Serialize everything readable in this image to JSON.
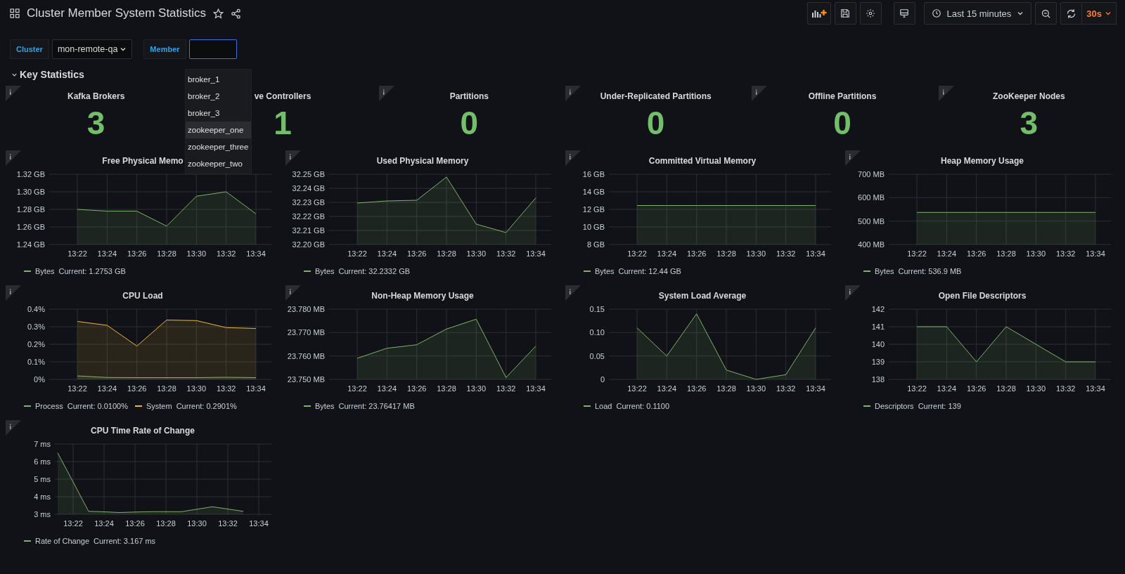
{
  "dashboard": {
    "title": "Cluster Member System Statistics"
  },
  "toolbar": {
    "time_range": "Last 15 minutes",
    "refresh_interval": "30s"
  },
  "variables": [
    {
      "label": "Cluster",
      "kind": "select",
      "value": "mon-remote-qa"
    },
    {
      "label": "Member",
      "kind": "input",
      "focused": true
    }
  ],
  "member_options": [
    {
      "label": "broker_1",
      "selected": false
    },
    {
      "label": "broker_2",
      "selected": false
    },
    {
      "label": "broker_3",
      "selected": false
    },
    {
      "label": "zookeeper_one",
      "selected": true
    },
    {
      "label": "zookeeper_three",
      "selected": false
    },
    {
      "label": "zookeeper_two",
      "selected": false
    }
  ],
  "row": {
    "title": "Key Statistics",
    "expanded": true
  },
  "stats": [
    {
      "title": "Kafka Brokers",
      "value": "3",
      "info_icon": true
    },
    {
      "title": "ve Controllers",
      "value": "1",
      "info_icon": false
    },
    {
      "title": "Partitions",
      "value": "0",
      "info_icon": true
    },
    {
      "title": "Under-Replicated Partitions",
      "value": "0",
      "info_icon": true
    },
    {
      "title": "Offline Partitions",
      "value": "0",
      "info_icon": true
    },
    {
      "title": "ZooKeeper Nodes",
      "value": "3",
      "info_icon": true
    }
  ],
  "panels": [
    {
      "title": "Free Physical Memo",
      "legend": [
        {
          "current": "Current: 1.2753 GB"
        }
      ],
      "chart_data": {
        "type": "area",
        "grid": true,
        "categories": [
          "13:22",
          "13:24",
          "13:26",
          "13:28",
          "13:30",
          "13:32",
          "13:34"
        ],
        "ylim": [
          1.24,
          1.32
        ],
        "yticks": [
          {
            "value": 1.24,
            "label": "1.24 GB"
          },
          {
            "value": 1.26,
            "label": "1.26 GB"
          },
          {
            "value": 1.28,
            "label": "1.28 GB"
          },
          {
            "value": 1.3,
            "label": "1.30 GB"
          },
          {
            "value": 1.32,
            "label": "1.32 GB"
          }
        ],
        "series": [
          {
            "name": "Bytes",
            "color": "#7eb26d",
            "values": [
              1.28,
              1.278,
              1.278,
              1.261,
              1.295,
              1.3,
              1.275
            ]
          }
        ]
      }
    },
    {
      "title": "Used Physical Memory",
      "legend": [
        {
          "current": "Current: 32.2332 GB"
        }
      ],
      "chart_data": {
        "type": "area",
        "grid": true,
        "categories": [
          "13:22",
          "13:24",
          "13:26",
          "13:28",
          "13:30",
          "13:32",
          "13:34"
        ],
        "ylim": [
          32.2,
          32.25
        ],
        "yticks": [
          {
            "value": 32.2,
            "label": "32.20 GB"
          },
          {
            "value": 32.21,
            "label": "32.21 GB"
          },
          {
            "value": 32.22,
            "label": "32.22 GB"
          },
          {
            "value": 32.23,
            "label": "32.23 GB"
          },
          {
            "value": 32.24,
            "label": "32.24 GB"
          },
          {
            "value": 32.25,
            "label": "32.25 GB"
          }
        ],
        "series": [
          {
            "name": "Bytes",
            "color": "#7eb26d",
            "values": [
              32.2295,
              32.231,
              32.2315,
              32.248,
              32.2145,
              32.2085,
              32.2332
            ]
          }
        ]
      }
    },
    {
      "title": "Committed Virtual Memory",
      "legend": [
        {
          "current": "Current: 12.44 GB"
        }
      ],
      "chart_data": {
        "type": "area",
        "grid": true,
        "categories": [
          "13:22",
          "13:24",
          "13:26",
          "13:28",
          "13:30",
          "13:32",
          "13:34"
        ],
        "ylim": [
          8,
          16
        ],
        "yticks": [
          {
            "value": 8,
            "label": "8 GB"
          },
          {
            "value": 10,
            "label": "10 GB"
          },
          {
            "value": 12,
            "label": "12 GB"
          },
          {
            "value": 14,
            "label": "14 GB"
          },
          {
            "value": 16,
            "label": "16 GB"
          }
        ],
        "series": [
          {
            "name": "Bytes",
            "color": "#7eb26d",
            "values": [
              12.44,
              12.44,
              12.44,
              12.44,
              12.44,
              12.44,
              12.44
            ]
          }
        ]
      }
    },
    {
      "title": "Heap Memory Usage",
      "legend": [
        {
          "current": "Current: 536.9 MB"
        }
      ],
      "chart_data": {
        "type": "area",
        "grid": true,
        "categories": [
          "13:22",
          "13:24",
          "13:26",
          "13:28",
          "13:30",
          "13:32",
          "13:34"
        ],
        "ylim": [
          400,
          700
        ],
        "yticks": [
          {
            "value": 400,
            "label": "400 MB"
          },
          {
            "value": 500,
            "label": "500 MB"
          },
          {
            "value": 600,
            "label": "600 MB"
          },
          {
            "value": 700,
            "label": "700 MB"
          }
        ],
        "series": [
          {
            "name": "Bytes",
            "color": "#7eb26d",
            "values": [
              537,
              537,
              537,
              537,
              537,
              537,
              537
            ]
          }
        ]
      }
    },
    {
      "title": "CPU Load",
      "legend": [
        {
          "current": "Current: 0.0100%"
        },
        {
          "current": "Current: 0.2901%"
        }
      ],
      "chart_data": {
        "type": "area",
        "grid": true,
        "categories": [
          "13:22",
          "13:24",
          "13:26",
          "13:28",
          "13:30",
          "13:32",
          "13:34"
        ],
        "ylim": [
          0,
          0.4
        ],
        "yticks": [
          {
            "value": 0,
            "label": "0%"
          },
          {
            "value": 0.1,
            "label": "0.1%"
          },
          {
            "value": 0.2,
            "label": "0.2%"
          },
          {
            "value": 0.3,
            "label": "0.3%"
          },
          {
            "value": 0.4,
            "label": "0.4%"
          }
        ],
        "series": [
          {
            "name": "Process",
            "color": "#7eb26d",
            "values": [
              0.02,
              0.011,
              0.01,
              0.01,
              0.01,
              0.012,
              0.01
            ]
          },
          {
            "name": "System",
            "color": "#eab839",
            "values": [
              0.33,
              0.308,
              0.19,
              0.338,
              0.335,
              0.295,
              0.29
            ]
          }
        ]
      }
    },
    {
      "title": "Non-Heap Memory Usage",
      "legend": [
        {
          "current": "Current: 23.76417 MB"
        }
      ],
      "chart_data": {
        "type": "area",
        "grid": true,
        "categories": [
          "13:22",
          "13:24",
          "13:26",
          "13:28",
          "13:30",
          "13:32",
          "13:34"
        ],
        "ylim": [
          23.75,
          23.78
        ],
        "yticks": [
          {
            "value": 23.75,
            "label": "23.750 MB"
          },
          {
            "value": 23.76,
            "label": "23.760 MB"
          },
          {
            "value": 23.77,
            "label": "23.770 MB"
          },
          {
            "value": 23.78,
            "label": "23.780 MB"
          }
        ],
        "series": [
          {
            "name": "Bytes",
            "color": "#7eb26d",
            "values": [
              23.759,
              23.7633,
              23.7648,
              23.7715,
              23.7757,
              23.7508,
              23.7642
            ]
          }
        ]
      }
    },
    {
      "title": "System Load Average",
      "legend": [
        {
          "current": "Current: 0.1100"
        }
      ],
      "chart_data": {
        "type": "area",
        "grid": true,
        "categories": [
          "13:22",
          "13:24",
          "13:26",
          "13:28",
          "13:30",
          "13:32",
          "13:34"
        ],
        "ylim": [
          0,
          0.15
        ],
        "yticks": [
          {
            "value": 0,
            "label": "0"
          },
          {
            "value": 0.05,
            "label": "0.05"
          },
          {
            "value": 0.1,
            "label": "0.10"
          },
          {
            "value": 0.15,
            "label": "0.15"
          }
        ],
        "series": [
          {
            "name": "Load",
            "color": "#7eb26d",
            "values": [
              0.11,
              0.05,
              0.14,
              0.02,
              0,
              0.01,
              0.11
            ]
          }
        ]
      }
    },
    {
      "title": "Open File Descriptors",
      "legend": [
        {
          "current": "Current: 139"
        }
      ],
      "chart_data": {
        "type": "area",
        "grid": true,
        "categories": [
          "13:22",
          "13:24",
          "13:26",
          "13:28",
          "13:30",
          "13:32",
          "13:34"
        ],
        "ylim": [
          138,
          142
        ],
        "yticks": [
          138,
          139,
          140,
          141,
          142
        ],
        "series": [
          {
            "name": "Descriptors",
            "color": "#7eb26d",
            "values": [
              141,
              141,
              139,
              141,
              140,
              139,
              139
            ]
          }
        ]
      }
    },
    {
      "title": "CPU Time Rate of Change",
      "legend": [
        {
          "current": "Current: 3.167 ms"
        }
      ],
      "chart_data": {
        "type": "area",
        "grid": true,
        "categories": [
          null,
          "13:22",
          null,
          "13:24",
          null,
          "13:26",
          null,
          "13:28",
          null,
          "13:30",
          null,
          "13:32",
          null,
          "13:34"
        ],
        "ylim": [
          3,
          7
        ],
        "yticks": [
          {
            "value": 3,
            "label": "3 ms"
          },
          {
            "value": 4,
            "label": "4 ms"
          },
          {
            "value": 5,
            "label": "5 ms"
          },
          {
            "value": 6,
            "label": "6 ms"
          },
          {
            "value": 7,
            "label": "7 ms"
          }
        ],
        "series": [
          {
            "name": "Rate of Change",
            "color": "#7eb26d",
            "values": [
              6.5,
              4.84,
              3.17,
              3.14,
              3.1,
              3.13,
              3.15,
              3.15,
              3.15,
              3.29,
              3.43,
              3.3,
              3.17,
              null
            ]
          }
        ]
      }
    }
  ]
}
